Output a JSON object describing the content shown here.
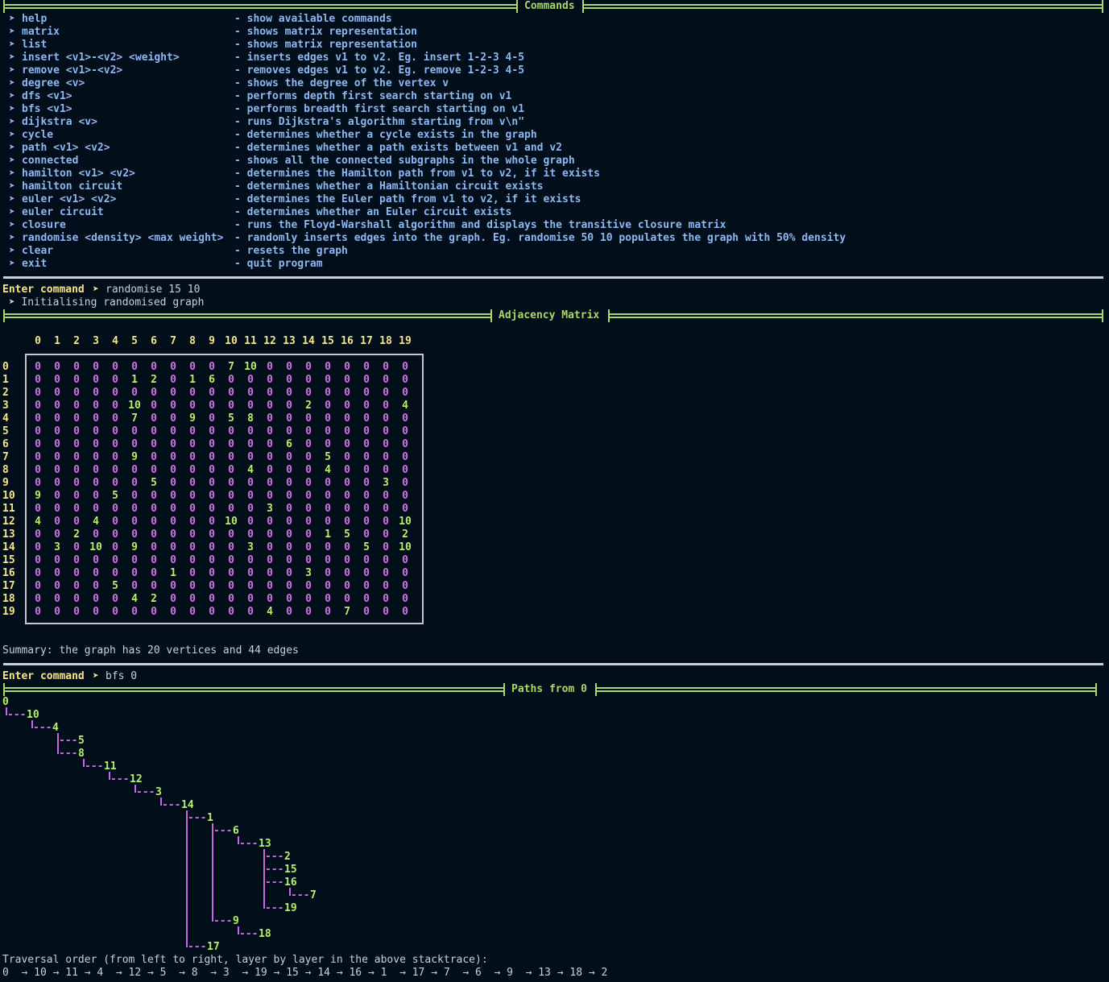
{
  "commands_title": "Commands",
  "commands": [
    {
      "cmd": "help",
      "desc": "- show available commands"
    },
    {
      "cmd": "matrix",
      "desc": "- shows matrix representation"
    },
    {
      "cmd": "list",
      "desc": "- shows matrix representation"
    },
    {
      "cmd": "insert <v1>-<v2> <weight>",
      "desc": "- inserts edges v1 to v2. Eg. insert 1-2-3 4-5"
    },
    {
      "cmd": "remove <v1>-<v2>",
      "desc": "- removes edges v1 to v2. Eg. remove 1-2-3 4-5"
    },
    {
      "cmd": "degree <v>",
      "desc": "- shows the degree of the vertex v"
    },
    {
      "cmd": "dfs <v1>",
      "desc": "- performs depth first search starting on v1"
    },
    {
      "cmd": "bfs <v1>",
      "desc": "- performs breadth first search starting on v1"
    },
    {
      "cmd": "dijkstra <v>",
      "desc": "- runs Dijkstra's algorithm starting from v\\n\""
    },
    {
      "cmd": "cycle",
      "desc": "- determines whether a cycle exists in the graph"
    },
    {
      "cmd": "path <v1> <v2>",
      "desc": "- determines whether a path exists between v1 and v2"
    },
    {
      "cmd": "connected",
      "desc": "- shows all the connected subgraphs in the whole graph"
    },
    {
      "cmd": "hamilton <v1> <v2>",
      "desc": "- determines the Hamilton path from v1 to v2, if it exists"
    },
    {
      "cmd": "hamilton circuit",
      "desc": "- determines whether a Hamiltonian circuit exists"
    },
    {
      "cmd": "euler <v1> <v2>",
      "desc": "- determines the Euler path from v1 to v2, if it exists"
    },
    {
      "cmd": "euler circuit",
      "desc": "- determines whether an Euler circuit exists"
    },
    {
      "cmd": "closure",
      "desc": "- runs the Floyd-Warshall algorithm and displays the transitive closure matrix"
    },
    {
      "cmd": "randomise <density> <max weight>",
      "desc": "- randomly inserts edges into the graph. Eg. randomise 50 10 populates the graph with 50% density"
    },
    {
      "cmd": "clear",
      "desc": "- resets the graph"
    },
    {
      "cmd": "exit",
      "desc": "- quit program"
    }
  ],
  "prompt_label": "Enter command",
  "prompt_arrow": "➤",
  "bullet": "➤",
  "session1": {
    "command": "randomise 15 10",
    "output": " ➤ Initialising randomised graph"
  },
  "matrix_title": "Adjacency Matrix",
  "matrix": [
    [
      0,
      0,
      0,
      0,
      0,
      0,
      0,
      0,
      0,
      0,
      7,
      10,
      0,
      0,
      0,
      0,
      0,
      0,
      0,
      0
    ],
    [
      0,
      0,
      0,
      0,
      0,
      1,
      2,
      0,
      1,
      6,
      0,
      0,
      0,
      0,
      0,
      0,
      0,
      0,
      0,
      0
    ],
    [
      0,
      0,
      0,
      0,
      0,
      0,
      0,
      0,
      0,
      0,
      0,
      0,
      0,
      0,
      0,
      0,
      0,
      0,
      0,
      0
    ],
    [
      0,
      0,
      0,
      0,
      0,
      10,
      0,
      0,
      0,
      0,
      0,
      0,
      0,
      0,
      2,
      0,
      0,
      0,
      0,
      4
    ],
    [
      0,
      0,
      0,
      0,
      0,
      7,
      0,
      0,
      9,
      0,
      5,
      8,
      0,
      0,
      0,
      0,
      0,
      0,
      0,
      0
    ],
    [
      0,
      0,
      0,
      0,
      0,
      0,
      0,
      0,
      0,
      0,
      0,
      0,
      0,
      0,
      0,
      0,
      0,
      0,
      0,
      0
    ],
    [
      0,
      0,
      0,
      0,
      0,
      0,
      0,
      0,
      0,
      0,
      0,
      0,
      0,
      6,
      0,
      0,
      0,
      0,
      0,
      0
    ],
    [
      0,
      0,
      0,
      0,
      0,
      9,
      0,
      0,
      0,
      0,
      0,
      0,
      0,
      0,
      0,
      5,
      0,
      0,
      0,
      0
    ],
    [
      0,
      0,
      0,
      0,
      0,
      0,
      0,
      0,
      0,
      0,
      0,
      4,
      0,
      0,
      0,
      4,
      0,
      0,
      0,
      0
    ],
    [
      0,
      0,
      0,
      0,
      0,
      0,
      5,
      0,
      0,
      0,
      0,
      0,
      0,
      0,
      0,
      0,
      0,
      0,
      3,
      0
    ],
    [
      9,
      0,
      0,
      0,
      5,
      0,
      0,
      0,
      0,
      0,
      0,
      0,
      0,
      0,
      0,
      0,
      0,
      0,
      0,
      0
    ],
    [
      0,
      0,
      0,
      0,
      0,
      0,
      0,
      0,
      0,
      0,
      0,
      0,
      3,
      0,
      0,
      0,
      0,
      0,
      0,
      0
    ],
    [
      4,
      0,
      0,
      4,
      0,
      0,
      0,
      0,
      0,
      0,
      10,
      0,
      0,
      0,
      0,
      0,
      0,
      0,
      0,
      10
    ],
    [
      0,
      0,
      2,
      0,
      0,
      0,
      0,
      0,
      0,
      0,
      0,
      0,
      0,
      0,
      0,
      1,
      5,
      0,
      0,
      2
    ],
    [
      0,
      3,
      0,
      10,
      0,
      9,
      0,
      0,
      0,
      0,
      0,
      3,
      0,
      0,
      0,
      0,
      0,
      5,
      0,
      10
    ],
    [
      0,
      0,
      0,
      0,
      0,
      0,
      0,
      0,
      0,
      0,
      0,
      0,
      0,
      0,
      0,
      0,
      0,
      0,
      0,
      0
    ],
    [
      0,
      0,
      0,
      0,
      0,
      0,
      0,
      1,
      0,
      0,
      0,
      0,
      0,
      0,
      3,
      0,
      0,
      0,
      0,
      0
    ],
    [
      0,
      0,
      0,
      0,
      5,
      0,
      0,
      0,
      0,
      0,
      0,
      0,
      0,
      0,
      0,
      0,
      0,
      0,
      0,
      0
    ],
    [
      0,
      0,
      0,
      0,
      0,
      4,
      2,
      0,
      0,
      0,
      0,
      0,
      0,
      0,
      0,
      0,
      0,
      0,
      0,
      0
    ],
    [
      0,
      0,
      0,
      0,
      0,
      0,
      0,
      0,
      0,
      0,
      0,
      0,
      4,
      0,
      0,
      0,
      7,
      0,
      0,
      0
    ]
  ],
  "summary": "Summary: the graph has 20 vertices and 44 edges",
  "session2": {
    "command": "bfs 0"
  },
  "paths_title": "Paths from 0",
  "tree_root": "0",
  "tree": [
    {
      "label": "10",
      "depth": 1
    },
    {
      "label": "4",
      "depth": 2
    },
    {
      "label": "5",
      "depth": 3
    },
    {
      "label": "8",
      "depth": 3
    },
    {
      "label": "11",
      "depth": 4
    },
    {
      "label": "12",
      "depth": 5
    },
    {
      "label": "3",
      "depth": 6
    },
    {
      "label": "14",
      "depth": 7
    },
    {
      "label": "1",
      "depth": 8
    },
    {
      "label": "6",
      "depth": 9
    },
    {
      "label": "13",
      "depth": 10
    },
    {
      "label": "2",
      "depth": 11
    },
    {
      "label": "15",
      "depth": 11
    },
    {
      "label": "16",
      "depth": 11
    },
    {
      "label": "7",
      "depth": 12
    },
    {
      "label": "19",
      "depth": 11
    },
    {
      "label": "9",
      "depth": 9
    },
    {
      "label": "18",
      "depth": 10
    },
    {
      "label": "17",
      "depth": 8
    }
  ],
  "traversal_label": "Traversal order (from left to right, layer by layer in the above stacktrace):",
  "traversal_order": "0  → 10 → 11 → 4  → 12 → 5  → 8  → 3  → 19 → 15 → 14 → 16 → 1  → 17 → 7  → 6  → 9  → 13 → 18 → 2"
}
